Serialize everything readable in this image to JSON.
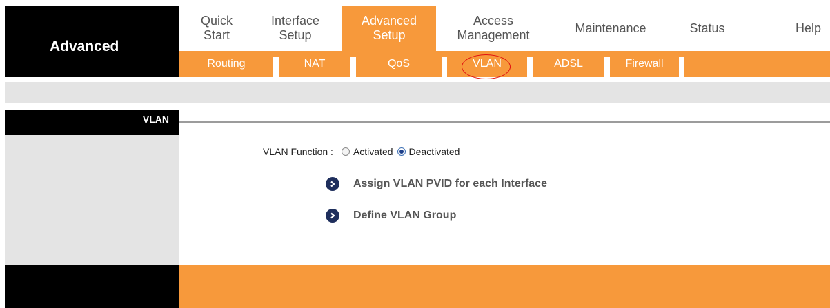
{
  "brand": {
    "title": "Advanced"
  },
  "topnav": {
    "items": [
      {
        "label": "Quick\nStart",
        "active": false
      },
      {
        "label": "Interface\nSetup",
        "active": false
      },
      {
        "label": "Advanced\nSetup",
        "active": true
      },
      {
        "label": "Access\nManagement",
        "active": false
      },
      {
        "label": "Maintenance",
        "active": false
      },
      {
        "label": "Status",
        "active": false
      },
      {
        "label": "Help",
        "active": false
      }
    ]
  },
  "subnav": {
    "items": [
      {
        "label": "Routing"
      },
      {
        "label": "NAT"
      },
      {
        "label": "QoS"
      },
      {
        "label": "VLAN"
      },
      {
        "label": "ADSL"
      },
      {
        "label": "Firewall"
      }
    ]
  },
  "sidebar": {
    "section_title": "VLAN"
  },
  "vlan_function": {
    "label": "VLAN Function :",
    "options": [
      {
        "label": "Activated",
        "checked": false
      },
      {
        "label": "Deactivated",
        "checked": true
      }
    ]
  },
  "links": [
    {
      "label": "Assign VLAN PVID for each Interface",
      "icon": "arrow-right-circle-icon"
    },
    {
      "label": "Define VLAN Group",
      "icon": "arrow-right-circle-icon"
    }
  ],
  "colors": {
    "accent": "#f7993b",
    "header_bg": "#000000",
    "panel_bg": "#e4e4e4",
    "annotation": "#e01010"
  }
}
